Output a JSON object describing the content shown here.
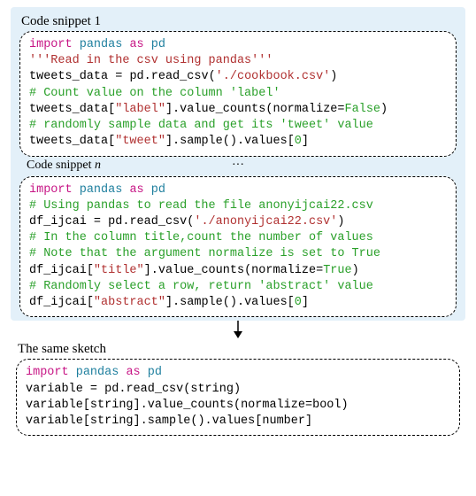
{
  "labels": {
    "snippet1": "Code snippet 1",
    "snippetN": "Code snippet",
    "snippetN_italic": "n",
    "ellipsis": "···",
    "sameSketch": "The same sketch"
  },
  "snippet1": {
    "l1_import": "import",
    "l1_pandas": "pandas",
    "l1_as": "as",
    "l1_pd": "pd",
    "l2_docstr": "'''Read in the csv using pandas'''",
    "l3_var": "tweets_data",
    "l3_eq": " = ",
    "l3_pd": "pd",
    "l3_dot": ".",
    "l3_read": "read_csv",
    "l3_arg": "'./cookbook.csv'",
    "l4_comment": "# Count value on the column 'label'",
    "l5_var": "tweets_data",
    "l5_key": "\"label\"",
    "l5_vc": "value_counts",
    "l5_norm": "normalize",
    "l5_val": "False",
    "l6_comment": "# randomly sample data and get its 'tweet' value",
    "l7_var": "tweets_data",
    "l7_key": "\"tweet\"",
    "l7_sample": "sample",
    "l7_values": "values",
    "l7_idx": "0"
  },
  "snippetN": {
    "l1_import": "import",
    "l1_pandas": "pandas",
    "l1_as": "as",
    "l1_pd": "pd",
    "l2_comment": "# Using pandas to read the file anonyijcai22.csv",
    "l3_var": "df_ijcai",
    "l3_pd": "pd",
    "l3_read": "read_csv",
    "l3_arg": "'./anonyijcai22.csv'",
    "l4_comment": "# In the column title,count the number of values",
    "l5_comment": "# Note that the argument normalize is set to True",
    "l6_var": "df_ijcai",
    "l6_key": "\"title\"",
    "l6_vc": "value_counts",
    "l6_norm": "normalize",
    "l6_val": "True",
    "l7_comment": "# Randomly select a row, return 'abstract' value",
    "l8_var": "df_ijcai",
    "l8_key": "\"abstract\"",
    "l8_sample": "sample",
    "l8_values": "values",
    "l8_idx": "0"
  },
  "sketch": {
    "l1_import": "import",
    "l1_pandas": "pandas",
    "l1_as": "as",
    "l1_pd": "pd",
    "l2_var": "variable",
    "l2_pd": "pd",
    "l2_read": "read_csv",
    "l2_arg": "string",
    "l3_var": "variable",
    "l3_key": "string",
    "l3_vc": "value_counts",
    "l3_norm": "normalize",
    "l3_val": "bool",
    "l4_var": "variable",
    "l4_key": "string",
    "l4_sample": "sample",
    "l4_values": "values",
    "l4_idx": "number"
  }
}
